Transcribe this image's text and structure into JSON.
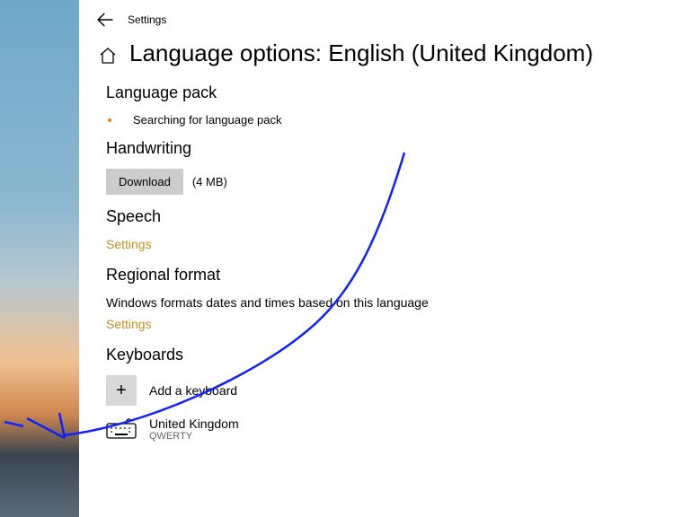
{
  "header": {
    "app_title": "Settings",
    "page_title": "Language options: English (United Kingdom)"
  },
  "sections": {
    "language_pack": {
      "heading": "Language pack",
      "status": "Searching for language pack"
    },
    "handwriting": {
      "heading": "Handwriting",
      "download_label": "Download",
      "download_size": "(4 MB)"
    },
    "speech": {
      "heading": "Speech",
      "settings_link": "Settings"
    },
    "regional": {
      "heading": "Regional format",
      "description": "Windows formats dates and times based on this language",
      "settings_link": "Settings"
    },
    "keyboards": {
      "heading": "Keyboards",
      "add_label": "Add a keyboard",
      "items": [
        {
          "name": "United Kingdom",
          "layout": "QWERTY"
        }
      ]
    }
  }
}
